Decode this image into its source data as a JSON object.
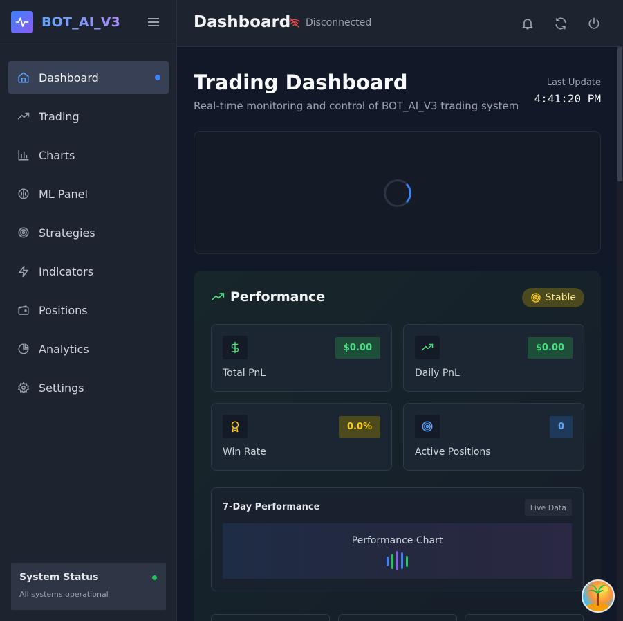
{
  "sidebar": {
    "brand": "BOT_AI_V3",
    "items": [
      {
        "label": "Dashboard",
        "icon": "home-icon",
        "active": true
      },
      {
        "label": "Trading",
        "icon": "trending-up-icon"
      },
      {
        "label": "Charts",
        "icon": "bar-chart-icon"
      },
      {
        "label": "ML Panel",
        "icon": "brain-icon"
      },
      {
        "label": "Strategies",
        "icon": "target-icon"
      },
      {
        "label": "Indicators",
        "icon": "zap-icon"
      },
      {
        "label": "Positions",
        "icon": "wallet-icon"
      },
      {
        "label": "Analytics",
        "icon": "pie-chart-icon"
      },
      {
        "label": "Settings",
        "icon": "gear-icon"
      }
    ],
    "system_status": {
      "title": "System Status",
      "subtitle": "All systems operational",
      "status_color": "#22c55e"
    }
  },
  "header": {
    "title": "Dashboard",
    "connection": "Disconnected"
  },
  "main": {
    "title": "Trading Dashboard",
    "subtitle": "Real-time monitoring and control of BOT_AI_V3 trading system",
    "last_update_label": "Last Update",
    "last_update_time": "4:41:20 PM",
    "performance": {
      "title": "Performance",
      "badge": "Stable",
      "stats": [
        {
          "label": "Total PnL",
          "value": "$0.00",
          "icon": "dollar-icon",
          "color": "green"
        },
        {
          "label": "Daily PnL",
          "value": "$0.00",
          "icon": "trending-up-icon",
          "color": "green"
        },
        {
          "label": "Win Rate",
          "value": "0.0%",
          "icon": "award-icon",
          "color": "yellow"
        },
        {
          "label": "Active Positions",
          "value": "0",
          "icon": "target-icon",
          "color": "blue"
        }
      ],
      "seven_day": {
        "title": "7-Day Performance",
        "badge": "Live Data",
        "chart_label": "Performance Chart"
      }
    }
  },
  "colors": {
    "accent": "#3b82f6",
    "success": "#4ade80",
    "warning": "#facc15",
    "danger": "#ef4444"
  }
}
